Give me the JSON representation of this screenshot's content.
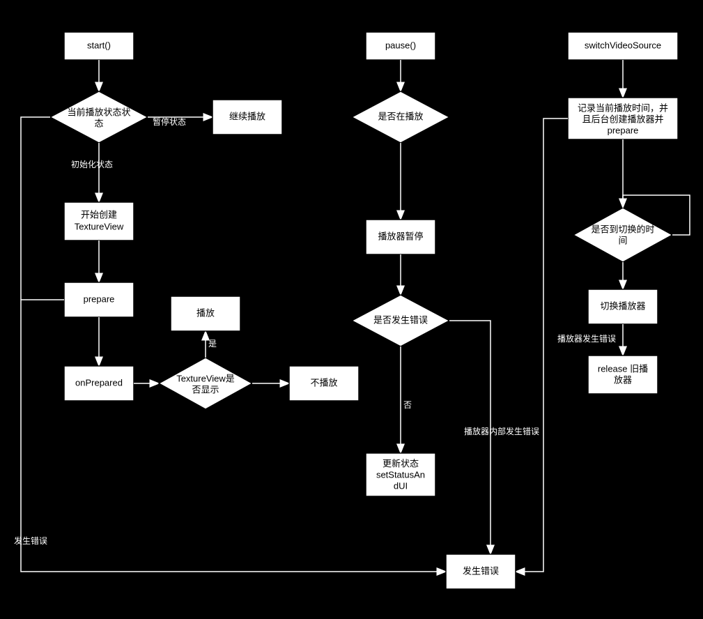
{
  "nodes": {
    "start": "start()",
    "state": [
      "当前播放状态状",
      "态"
    ],
    "edge_pause_state": "暂停状态",
    "resume": "继续播放",
    "edge_init_state": "初始化状态",
    "createTV": [
      "开始创建",
      "TextureView"
    ],
    "prepare": "prepare",
    "onPrepared": "onPrepared",
    "tvShown": [
      "TextureView是",
      "否显示"
    ],
    "edge_yes": "是",
    "play": "播放",
    "noplay": "不播放",
    "edge_err_label": "发生错误",
    "pause": "pause()",
    "isPlaying": "是否在播放",
    "playerPause": "播放器暂停",
    "isError": "是否发生错误",
    "edge_no": "否",
    "updateStatus": [
      "更新状态",
      "setStatusAn",
      "dUI"
    ],
    "edge_internal_err": "播放器内部发生错误",
    "switchSrc": "switchVideoSource",
    "record": [
      "记录当前播放时间，并",
      "且后台创建播放器并",
      "prepare"
    ],
    "reachTime": [
      "是否到切换的时",
      "间"
    ],
    "switchPlayer": "切换播放器",
    "releaseOld": [
      "release 旧播",
      "放器"
    ],
    "edge_player_err": "播放器发生错误",
    "errorBox": "发生错误"
  }
}
